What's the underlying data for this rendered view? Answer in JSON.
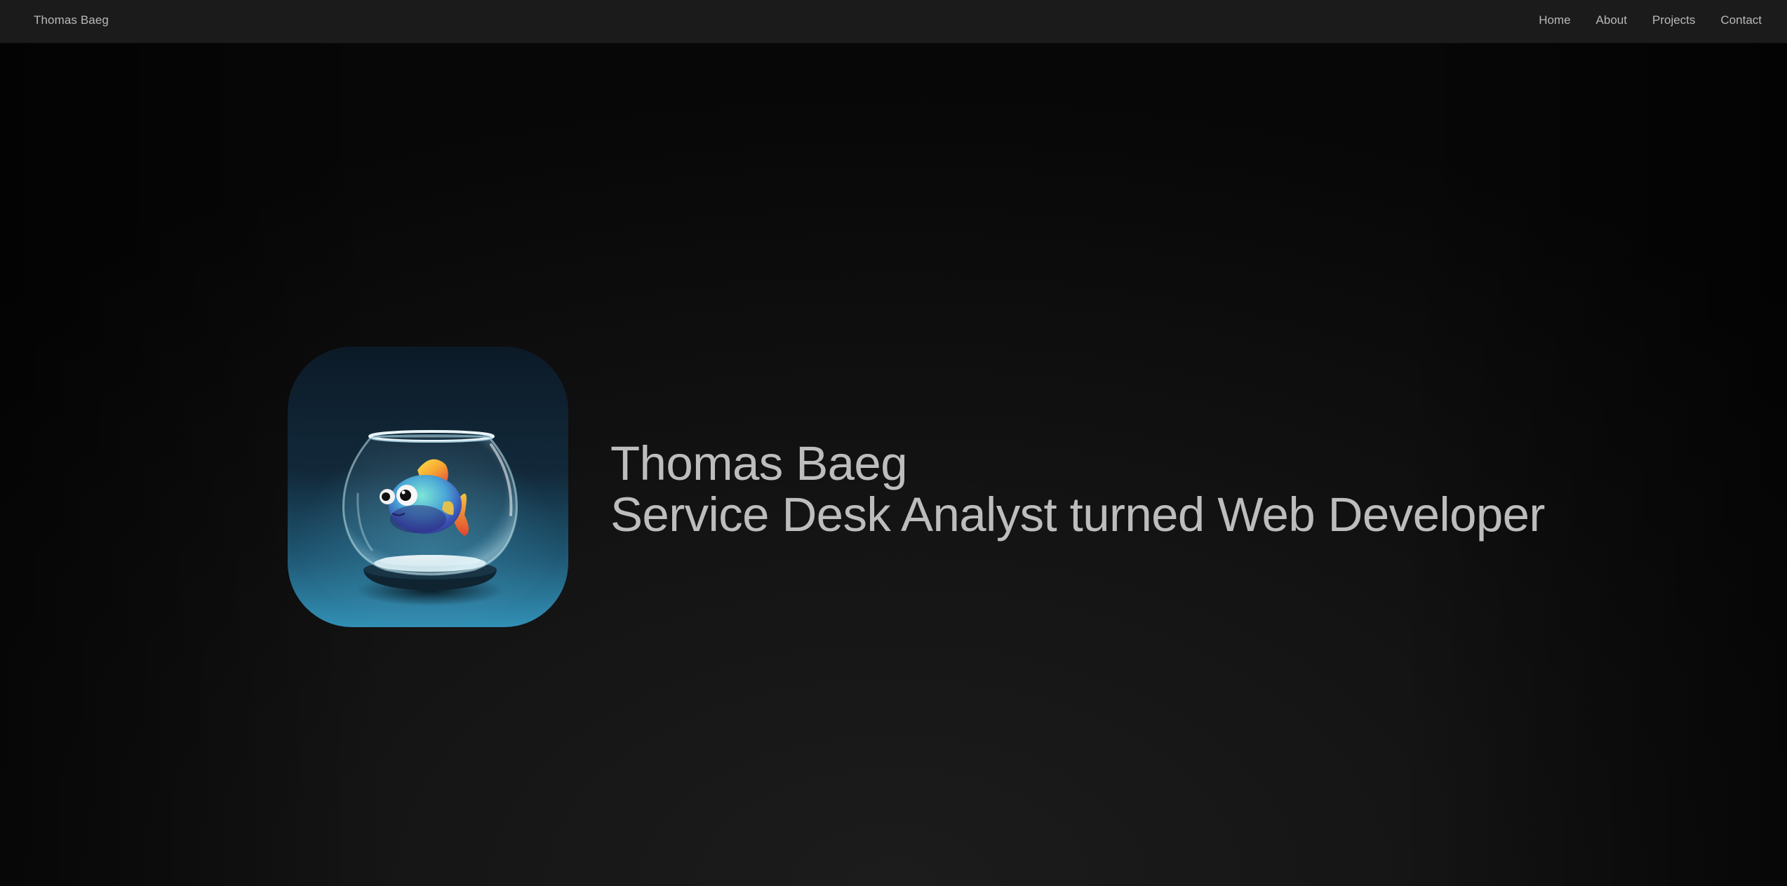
{
  "navbar": {
    "brand": "Thomas Baeg",
    "links": [
      {
        "label": "Home"
      },
      {
        "label": "About"
      },
      {
        "label": "Projects"
      },
      {
        "label": "Contact"
      }
    ]
  },
  "hero": {
    "name": "Thomas Baeg",
    "tagline": "Service Desk Analyst turned Web Developer",
    "avatar_icon": "fishbowl-icon"
  },
  "colors": {
    "background": "#0b0b0b",
    "navbar": "#1b1b1b",
    "text": "#bdbdbd",
    "avatar_top": "#0d1b28",
    "avatar_bottom": "#2f86a8"
  }
}
